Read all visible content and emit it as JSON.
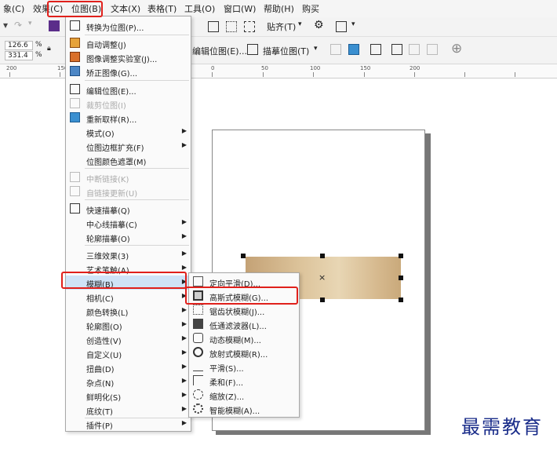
{
  "menubar": {
    "items": [
      "象(C)",
      "效果(C)",
      "位图(B)",
      "文本(X)",
      "表格(T)",
      "工具(O)",
      "窗口(W)",
      "帮助(H)",
      "购买"
    ]
  },
  "toolbar1": {
    "snap_label": "贴齐(T)",
    "snap_arrow": "▾",
    "menu_arrow": "▾"
  },
  "toolbar2": {
    "size_w": "126.6",
    "size_h": "331.4",
    "unit_w": "%",
    "unit_h": "%",
    "edit_bitmap": "编辑位图(E)...",
    "trace_bitmap": "描摹位图(T)",
    "trace_arrow": "▾",
    "add_icon": "⊕"
  },
  "ruler": {
    "labels": [
      "200",
      "150",
      "0",
      "50",
      "100",
      "150",
      "200"
    ]
  },
  "bitmap_menu": {
    "items": [
      {
        "label": "转换为位图(P)...",
        "icon": "convert-bitmap-icon",
        "enabled": true
      },
      {
        "label": "自动调整(J)",
        "icon": "auto-adjust-icon",
        "enabled": true
      },
      {
        "label": "图像调整实验室(J)...",
        "icon": "image-adjust-lab-icon",
        "enabled": true
      },
      {
        "label": "矫正图像(G)...",
        "icon": "straighten-image-icon",
        "enabled": true
      },
      {
        "label": "编辑位图(E)...",
        "icon": "edit-bitmap-icon",
        "enabled": true
      },
      {
        "label": "裁剪位图(I)",
        "icon": "crop-bitmap-icon",
        "enabled": false
      },
      {
        "label": "重新取样(R)...",
        "icon": "resample-icon",
        "enabled": true
      },
      {
        "label": "模式(O)",
        "submenu": true,
        "enabled": true
      },
      {
        "label": "位图边框扩充(F)",
        "submenu": true,
        "enabled": true
      },
      {
        "label": "位图颜色遮罩(M)",
        "enabled": true
      },
      {
        "label": "中断链接(K)",
        "icon": "break-link-icon",
        "enabled": false
      },
      {
        "label": "自链接更新(U)",
        "icon": "update-link-icon",
        "enabled": false
      },
      {
        "label": "快速描摹(Q)",
        "icon": "quick-trace-icon",
        "enabled": true
      },
      {
        "label": "中心线描摹(C)",
        "submenu": true,
        "enabled": true
      },
      {
        "label": "轮廓描摹(O)",
        "submenu": true,
        "enabled": true
      },
      {
        "label": "三维效果(3)",
        "submenu": true,
        "enabled": true
      },
      {
        "label": "艺术笔触(A)",
        "submenu": true,
        "enabled": true
      },
      {
        "label": "模糊(B)",
        "submenu": true,
        "enabled": true,
        "highlighted": true
      },
      {
        "label": "相机(C)",
        "submenu": true,
        "enabled": true
      },
      {
        "label": "颜色转换(L)",
        "submenu": true,
        "enabled": true
      },
      {
        "label": "轮廓图(O)",
        "submenu": true,
        "enabled": true
      },
      {
        "label": "创造性(V)",
        "submenu": true,
        "enabled": true
      },
      {
        "label": "自定义(U)",
        "submenu": true,
        "enabled": true
      },
      {
        "label": "扭曲(D)",
        "submenu": true,
        "enabled": true
      },
      {
        "label": "杂点(N)",
        "submenu": true,
        "enabled": true
      },
      {
        "label": "鲜明化(S)",
        "submenu": true,
        "enabled": true
      },
      {
        "label": "底纹(T)",
        "submenu": true,
        "enabled": true
      },
      {
        "label": "插件(P)",
        "submenu": true,
        "enabled": true
      }
    ]
  },
  "blur_submenu": {
    "items": [
      {
        "label": "定向平滑(D)...",
        "icon": "directional-smooth-icon"
      },
      {
        "label": "高斯式模糊(G)...",
        "icon": "gaussian-blur-icon"
      },
      {
        "label": "锯齿状模糊(J)...",
        "icon": "jaggy-despeckle-icon"
      },
      {
        "label": "低通滤波器(L)...",
        "icon": "low-pass-icon"
      },
      {
        "label": "动态模糊(M)...",
        "icon": "motion-blur-icon"
      },
      {
        "label": "放射式模糊(R)...",
        "icon": "radial-blur-icon"
      },
      {
        "label": "平滑(S)...",
        "icon": "smooth-icon"
      },
      {
        "label": "柔和(F)...",
        "icon": "soften-icon"
      },
      {
        "label": "缩放(Z)...",
        "icon": "zoom-blur-icon"
      },
      {
        "label": "智能模糊(A)...",
        "icon": "smart-blur-icon"
      }
    ]
  },
  "submenu_arrow": "▶",
  "center_mark": "×",
  "watermark": "最需教育",
  "colors": {
    "highlight": "#cfe3f7",
    "annotation": "#e0201b",
    "watermark": "#1a2d8a"
  }
}
